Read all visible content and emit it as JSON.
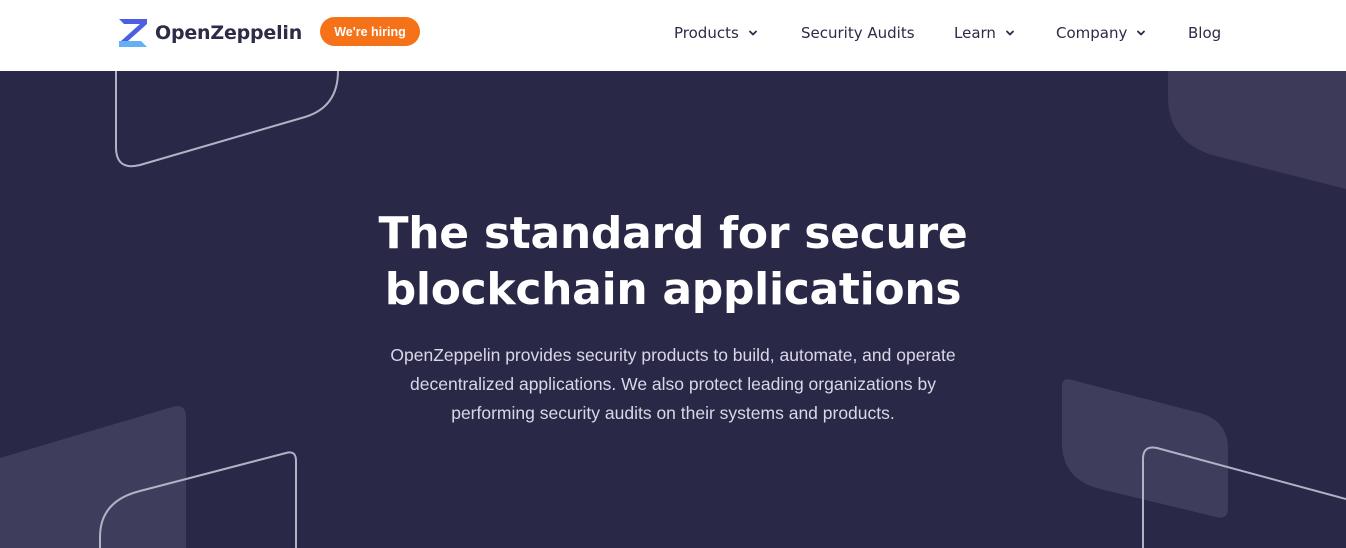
{
  "header": {
    "logo_text": "OpenZeppelin",
    "hiring_badge": "We're hiring",
    "nav": {
      "products": "Products",
      "security_audits": "Security Audits",
      "learn": "Learn",
      "company": "Company",
      "blog": "Blog"
    }
  },
  "hero": {
    "title_line1": "The standard for secure",
    "title_line2": "blockchain applications",
    "subtitle": "OpenZeppelin provides security products to build, automate, and operate decentralized applications. We also protect leading organizations by performing security audits on their systems and products."
  },
  "icons": {
    "logo": "openzeppelin-logo-icon",
    "dropdown": "chevron-down-icon"
  },
  "colors": {
    "hero_background": "#2a2847",
    "brand_dark": "#2c2b48",
    "hiring_orange": "#f57218",
    "logo_blue": "#4e5ee4",
    "logo_cyan": "#63b0f5"
  }
}
